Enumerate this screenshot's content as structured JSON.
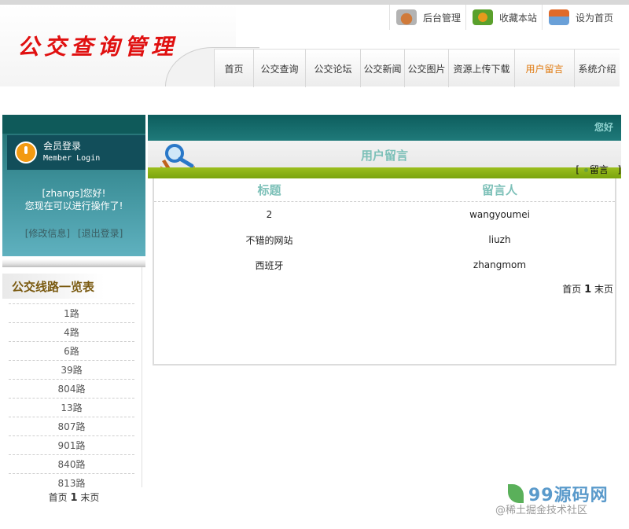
{
  "header": {
    "logo_text": "公交查询管理",
    "top_links": [
      {
        "label": "后台管理",
        "icon": "phone-icon"
      },
      {
        "label": "收藏本站",
        "icon": "favorite-icon"
      },
      {
        "label": "设为首页",
        "icon": "home-icon"
      }
    ],
    "nav": [
      {
        "label": "首页"
      },
      {
        "label": "公交查询"
      },
      {
        "label": "公交论坛"
      },
      {
        "label": "公交新闻"
      },
      {
        "label": "公交图片"
      },
      {
        "label": "资源上传下载"
      },
      {
        "label": "用户留言",
        "active": true
      },
      {
        "label": "系统介绍"
      }
    ]
  },
  "login": {
    "title": "会员登录",
    "subtitle": "Member Login",
    "greeting": "[zhangs]您好!",
    "message": "您现在可以进行操作了!",
    "edit_link": "[修改信息]",
    "logout_link": "[退出登录]"
  },
  "routes": {
    "title": "公交线路一览表",
    "items": [
      "1路",
      "4路",
      "6路",
      "39路",
      "804路",
      "13路",
      "807路",
      "901路",
      "840路",
      "813路"
    ],
    "pager": {
      "first": "首页",
      "page": "1",
      "last": "末页"
    }
  },
  "main": {
    "topbar_text": "您好",
    "panel_title": "用户留言",
    "action_open": "[",
    "action_label": "留言",
    "action_close": "]",
    "columns": [
      "标题",
      "留言人"
    ],
    "rows": [
      [
        "2",
        "wangyoumei"
      ],
      [
        "不错的网站",
        "liuzh"
      ],
      [
        "西班牙",
        "zhangmom"
      ]
    ],
    "pager": {
      "first": "首页",
      "page": "1",
      "last": "末页"
    }
  },
  "watermark": {
    "logo": "99源码网",
    "text": "@稀土掘金技术社区"
  },
  "colors": {
    "teal": "#0d5d5d",
    "green_bar": "#8ab31a",
    "logo_red": "#e01010",
    "accent_orange": "#e07a10"
  }
}
